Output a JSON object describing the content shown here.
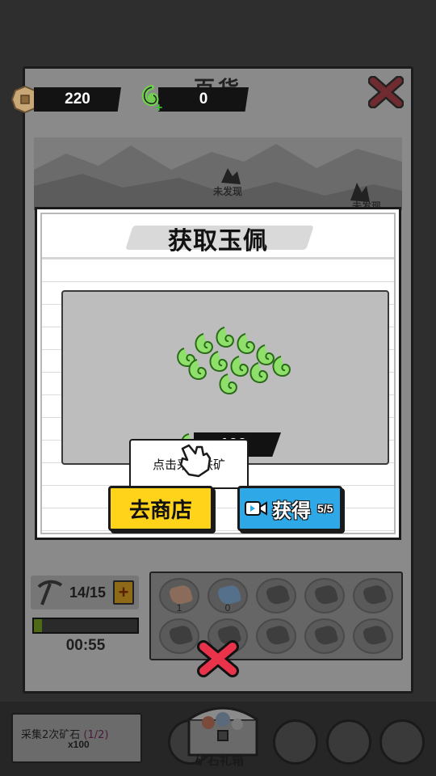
{
  "hud": {
    "coins": "220",
    "jade": "0"
  },
  "background": {
    "title": "百货",
    "undiscovered_1": "未发现",
    "undiscovered_2": "未发现",
    "pickaxe_count": "14/15",
    "plus_label": "+",
    "progress_fraction": 0.08,
    "timer": "00:55",
    "ore_slots": [
      {
        "count": "1",
        "color": "#8b6b5a"
      },
      {
        "count": "0",
        "color": "#54708a"
      },
      {
        "count": "",
        "color": ""
      },
      {
        "count": "",
        "color": ""
      },
      {
        "count": "",
        "color": ""
      },
      {
        "count": "",
        "color": ""
      },
      {
        "count": "",
        "color": ""
      },
      {
        "count": "",
        "color": ""
      },
      {
        "count": "",
        "color": ""
      },
      {
        "count": "",
        "color": ""
      }
    ],
    "task_text": "采集2次矿石",
    "task_count": "(1/2)",
    "task_reward": "x100",
    "chest_label": "矿石礼箱"
  },
  "modal": {
    "title": "获取玉佩",
    "amount": "100",
    "tooltip": "点击采取铁矿",
    "shop_button": "去商店",
    "get_button": "获得",
    "get_count": "5/5"
  },
  "colors": {
    "shop_button": "#ffd31a",
    "get_button": "#2fa8e8",
    "close_red": "#e8334a",
    "jade_green": "#7fd35a"
  }
}
